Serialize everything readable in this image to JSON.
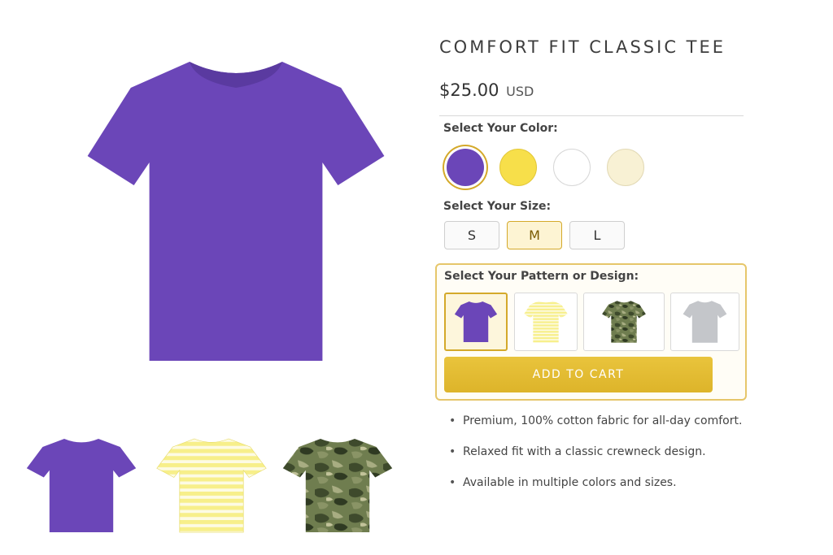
{
  "product": {
    "title": "COMFORT FIT CLASSIC TEE",
    "price": "$25.00",
    "currency": "USD",
    "main_image_color": "#6b46b8"
  },
  "gallery": {
    "thumbnails": [
      {
        "pattern": "solid",
        "color": "#6b46b8",
        "icon": "tshirt-purple"
      },
      {
        "pattern": "stripes",
        "color": "#f5ec7c",
        "icon": "tshirt-yellow-stripes"
      },
      {
        "pattern": "camo",
        "color": "#5d6b44",
        "icon": "tshirt-camo"
      }
    ]
  },
  "color_selector": {
    "label": "Select Your Color:",
    "options": [
      {
        "name": "purple",
        "hex": "#6b46b8",
        "selected": true
      },
      {
        "name": "yellow",
        "hex": "#f7df4a",
        "selected": false
      },
      {
        "name": "white",
        "hex": "#ffffff",
        "selected": false
      },
      {
        "name": "cream",
        "hex": "#f8f1d4",
        "selected": false
      }
    ]
  },
  "size_selector": {
    "label": "Select Your Size:",
    "options": [
      {
        "label": "S",
        "selected": false
      },
      {
        "label": "M",
        "selected": true
      },
      {
        "label": "L",
        "selected": false
      }
    ]
  },
  "pattern_selector": {
    "label": "Select Your Pattern or Design:",
    "options": [
      {
        "name": "solid-purple",
        "selected": true
      },
      {
        "name": "yellow-stripes",
        "selected": false
      },
      {
        "name": "camo",
        "selected": false
      },
      {
        "name": "heather-gray",
        "selected": false
      }
    ]
  },
  "cart": {
    "button_label": "ADD TO CART",
    "accent": "#e0b930"
  },
  "features": {
    "bullet": "•",
    "items": [
      "Premium, 100% cotton fabric for all-day comfort.",
      "Relaxed fit with a classic crewneck design.",
      "Available in multiple colors and sizes."
    ]
  }
}
